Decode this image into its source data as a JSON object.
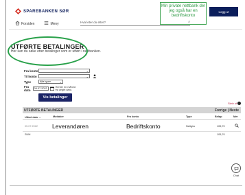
{
  "header": {
    "logo_text": "SPAREBANKEN SØR",
    "logout_label": "Logg ut",
    "annotation_note": "Min private nettbank der jeg også har en bedriftskonto"
  },
  "nav": {
    "home_label": "Forsiden",
    "menu_label": "Meny",
    "search_placeholder": "Hva leter du etter?"
  },
  "page": {
    "title": "UTFØRTE BETALINGER",
    "subtitle": "Her kan du søke etter betalinger som er utført i nettbanken."
  },
  "filter": {
    "from_account_label": "Fra konto",
    "from_account_value": "",
    "to_account_label": "Til konto",
    "to_account_value": "",
    "type_label": "Type",
    "type_value": "Alle typer",
    "from_date_label": "Fra dato",
    "from_date_value": "04.07.2022",
    "date_hint": "Henter en måned fra angitt dato.",
    "show_button": "Vis betalinger",
    "print_label": "Skriv ut"
  },
  "results": {
    "title": "UTFØRTE BETALINGER",
    "pager": "Forrige | Neste",
    "columns": {
      "date": "Utført dato",
      "recipient": "Mottaker",
      "from_account": "Fra konto",
      "type": "Type",
      "amount": "Beløp",
      "more": "Mer"
    },
    "rows": [
      {
        "date": "05.07.2022",
        "recipient": "Leverandøren",
        "from_account": "Bedriftskonto",
        "type": "Nettgiro",
        "amount": "105,70"
      }
    ],
    "sum_label": "SUM",
    "sum_value": "105,70"
  },
  "chat": {
    "label": "Chat"
  },
  "colors": {
    "brand_navy": "#0b1e5b",
    "annotation_green": "#2d9a44",
    "results_bar": "#d4d4d4"
  }
}
